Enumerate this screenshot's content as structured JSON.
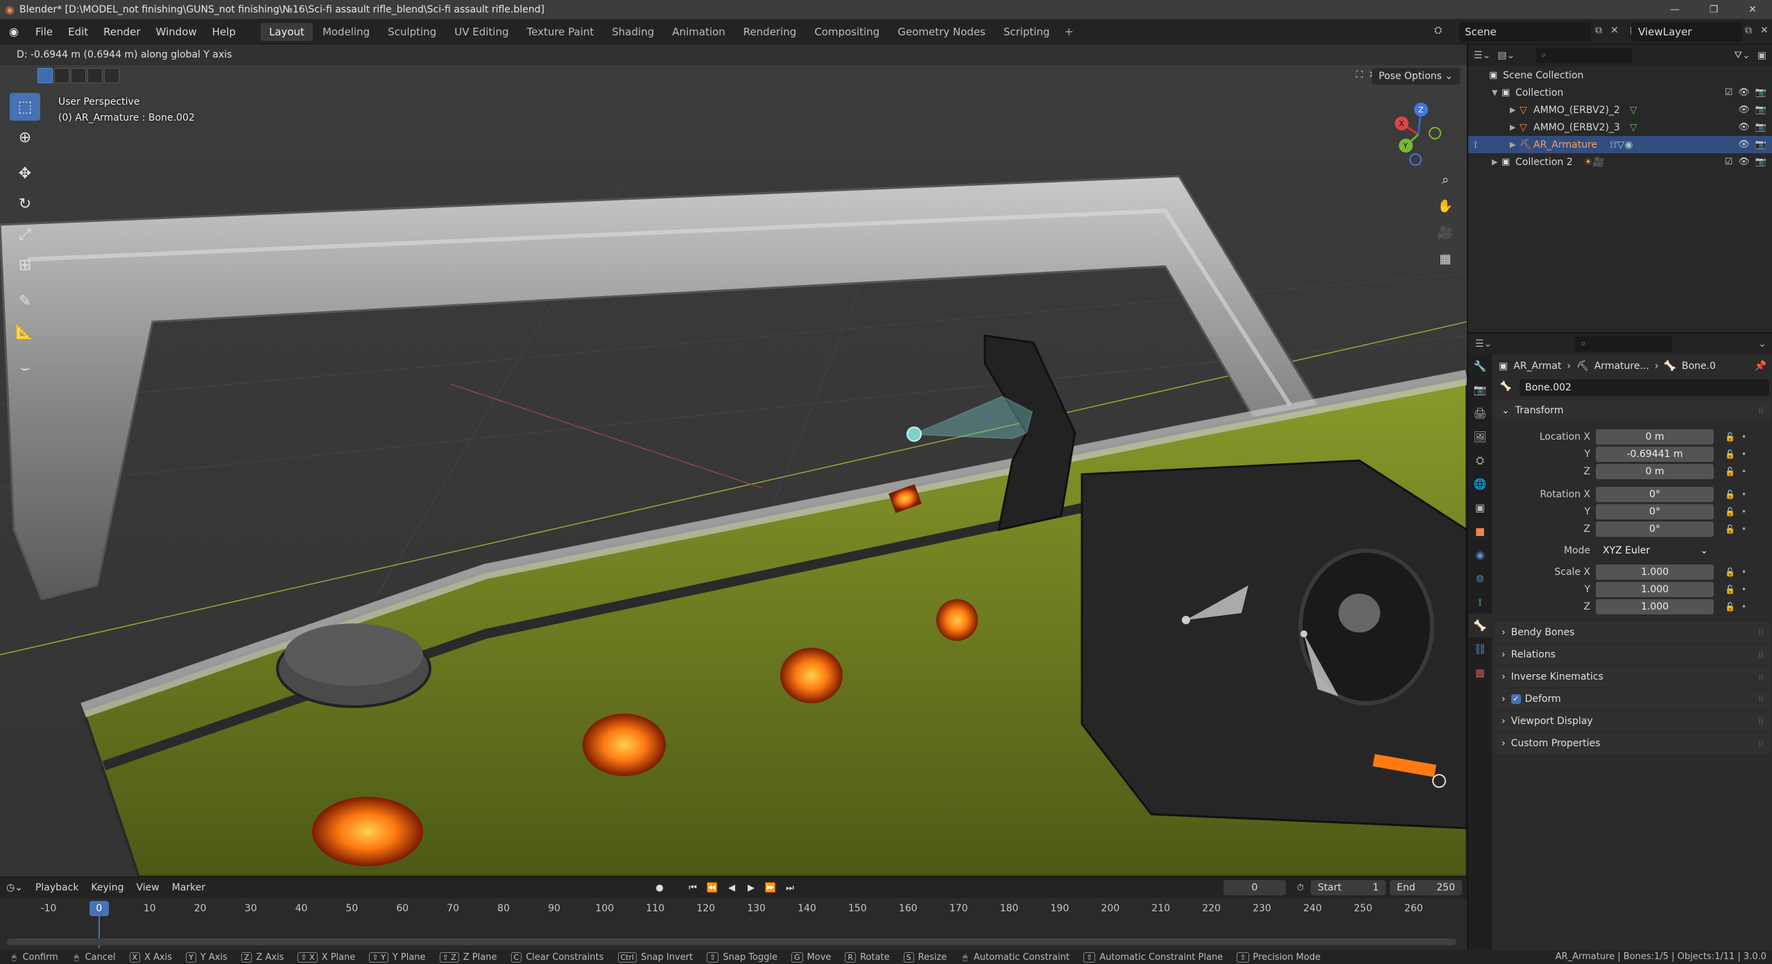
{
  "window": {
    "title": "Blender* [D:\\MODEL_not finishing\\GUNS_not finishing\\№16\\Sci-fi assault rifle_blend\\Sci-fi assault rifle.blend]",
    "controls": [
      "—",
      "❐",
      "✕"
    ]
  },
  "menu": {
    "items": [
      "File",
      "Edit",
      "Render",
      "Window",
      "Help"
    ],
    "workspaces": [
      "Layout",
      "Modeling",
      "Sculpting",
      "UV Editing",
      "Texture Paint",
      "Shading",
      "Animation",
      "Rendering",
      "Compositing",
      "Geometry Nodes",
      "Scripting"
    ],
    "active_workspace": "Layout",
    "add": "+",
    "scene": "Scene",
    "view_layer": "ViewLayer"
  },
  "viewport": {
    "status": "D: -0.6944 m (0.6944 m) along global Y axis",
    "perspective": "User Perspective",
    "active_object": "(0) AR_Armature : Bone.002",
    "pose_options": "Pose Options",
    "gizmo_axes": [
      "X",
      "Y",
      "Z"
    ],
    "tools": [
      "select-box-icon",
      "cursor-icon",
      "move-icon",
      "rotate-icon",
      "scale-icon",
      "transform-icon",
      "annotate-icon",
      "measure-icon",
      "bone-roll-icon"
    ],
    "nav": [
      "zoom-icon",
      "hand-icon",
      "camera-icon",
      "grid-icon"
    ]
  },
  "timeline": {
    "menus": [
      "Playback",
      "Keying",
      "View",
      "Marker"
    ],
    "current_frame": "0",
    "start_label": "Start",
    "start": "1",
    "end_label": "End",
    "end": "250",
    "ticks": [
      "-10",
      "0",
      "10",
      "20",
      "30",
      "40",
      "50",
      "60",
      "70",
      "80",
      "90",
      "100",
      "110",
      "120",
      "130",
      "140",
      "150",
      "160",
      "170",
      "180",
      "190",
      "200",
      "210",
      "220",
      "230",
      "240",
      "250",
      "260"
    ],
    "playhead": "0"
  },
  "outliner": {
    "search_placeholder": "",
    "rows": [
      {
        "label": "Scene Collection",
        "level": 0
      },
      {
        "label": "Collection",
        "level": 1
      },
      {
        "label": "AMMO_(ERBV2)_2",
        "level": 2
      },
      {
        "label": "AMMO_(ERBV2)_3",
        "level": 2
      },
      {
        "label": "AR_Armature",
        "level": 2,
        "selected": true
      },
      {
        "label": "Collection 2",
        "level": 1
      }
    ]
  },
  "properties": {
    "breadcrumb": [
      "AR_Armat",
      "Armature...",
      "Bone.0"
    ],
    "bone_name": "Bone.002",
    "transform": {
      "header": "Transform",
      "location_label": "Location X",
      "location": [
        "0 m",
        "-0.69441 m",
        "0 m"
      ],
      "rotation_label": "Rotation X",
      "rotation": [
        "0°",
        "0°",
        "0°"
      ],
      "mode_label": "Mode",
      "mode": "XYZ Euler",
      "scale_label": "Scale X",
      "scale": [
        "1.000",
        "1.000",
        "1.000"
      ],
      "axis_y": "Y",
      "axis_z": "Z"
    },
    "panels": [
      "Bendy Bones",
      "Relations",
      "Inverse Kinematics",
      "Deform",
      "Viewport Display",
      "Custom Properties"
    ]
  },
  "statusbar": {
    "items": [
      {
        "key": "",
        "label": "Confirm"
      },
      {
        "key": "",
        "label": "Cancel"
      },
      {
        "key": "X",
        "label": "X Axis"
      },
      {
        "key": "Y",
        "label": "Y Axis"
      },
      {
        "key": "Z",
        "label": "Z Axis"
      },
      {
        "key": "⇧ X",
        "label": "X Plane"
      },
      {
        "key": "⇧ Y",
        "label": "Y Plane"
      },
      {
        "key": "⇧ Z",
        "label": "Z Plane"
      },
      {
        "key": "C",
        "label": "Clear Constraints"
      },
      {
        "key": "Ctrl",
        "label": "Snap Invert"
      },
      {
        "key": "⇧",
        "label": "Snap Toggle"
      },
      {
        "key": "G",
        "label": "Move"
      },
      {
        "key": "R",
        "label": "Rotate"
      },
      {
        "key": "S",
        "label": "Resize"
      },
      {
        "key": "",
        "label": "Automatic Constraint"
      },
      {
        "key": "⇧",
        "label": "Automatic Constraint Plane"
      },
      {
        "key": "⇧",
        "label": "Precision Mode"
      }
    ],
    "right": "AR_Armature | Bones:1/5 | Objects:1/11 | 3.0.0"
  }
}
